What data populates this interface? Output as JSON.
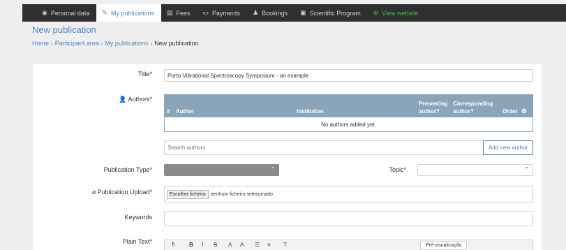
{
  "nav": {
    "items": [
      {
        "icon": "user-circle-icon",
        "glyph": "◉",
        "label": "Personal data",
        "active": false,
        "green": false
      },
      {
        "icon": "edit-icon",
        "glyph": "✎",
        "label": "My publications",
        "active": true,
        "green": false
      },
      {
        "icon": "receipt-icon",
        "glyph": "▤",
        "label": "Fees",
        "active": false,
        "green": false
      },
      {
        "icon": "money-icon",
        "glyph": "▭",
        "label": "Payments",
        "active": false,
        "green": false
      },
      {
        "icon": "user-plus-icon",
        "glyph": "♟",
        "label": "Bookings",
        "active": false,
        "green": false
      },
      {
        "icon": "clipboard-icon",
        "glyph": "▣",
        "label": "Scientific Program",
        "active": false,
        "green": false
      },
      {
        "icon": "globe-icon",
        "glyph": "⊕",
        "label": "View website",
        "active": false,
        "green": true
      }
    ]
  },
  "page": {
    "title": "New publication"
  },
  "breadcrumb": {
    "items": [
      "Home",
      "Participant area",
      "My publications"
    ],
    "current": "New publication"
  },
  "form": {
    "title_label": "Title*",
    "title_value": "Porto Vibrational Spectroscopy Symposium - an example",
    "authors_label": "Authors*",
    "authors_table": {
      "col_num": "#",
      "col_author": "Author",
      "col_institution": "Institution",
      "col_presenting_1": "Presenting",
      "col_presenting_2": "author?",
      "col_corresponding_1": "Corresponding",
      "col_corresponding_2": "author?",
      "col_order": "Order",
      "empty_text": "No authors added yet."
    },
    "search_placeholder": "Search authors",
    "add_author_label": "Add new author",
    "publication_type_label": "Publication Type*",
    "topic_label": "Topic*",
    "upload_label": "Publication Upload*",
    "file_button_label": "Escolher ficheiro",
    "file_status": "nenhum ficheiro selecionado",
    "keywords_label": "Keywords",
    "plain_text_label": "Plain Text*",
    "preview_label": "Pré-visualização"
  },
  "colors": {
    "accent": "#4a86c5",
    "nav_bg": "#2f2f30",
    "table_header": "#8aa5ba",
    "green": "#39c23d"
  }
}
